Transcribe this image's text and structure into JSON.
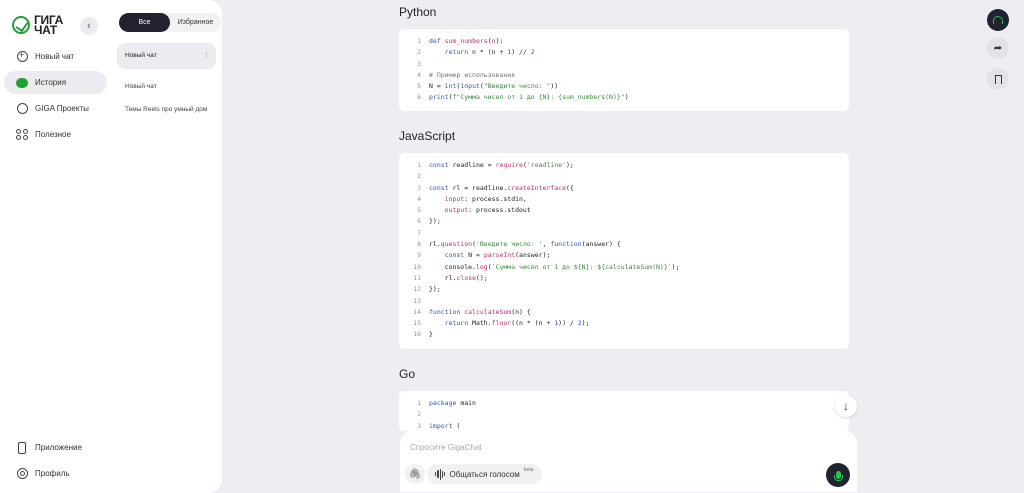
{
  "brand": {
    "name_line1": "ГИГА",
    "name_line2": "ЧАТ"
  },
  "nav": {
    "items": [
      {
        "label": "Новый чат",
        "icon": "plus-circle-icon"
      },
      {
        "label": "История",
        "icon": "chat-bubble-icon"
      },
      {
        "label": "GIGA Проекты",
        "icon": "projects-icon"
      },
      {
        "label": "Полезное",
        "icon": "grid-icon"
      }
    ],
    "bottom": [
      {
        "label": "Приложение",
        "icon": "phone-icon"
      },
      {
        "label": "Профиль",
        "icon": "profile-icon"
      }
    ]
  },
  "history": {
    "filters": [
      "Все",
      "Избранное"
    ],
    "items": [
      "Новый чат",
      "Новый чат",
      "Темы Reels про умный дом"
    ]
  },
  "sections": [
    {
      "title": "Python"
    },
    {
      "title": "JavaScript"
    },
    {
      "title": "Go"
    }
  ],
  "code": {
    "python": [
      "def sum_numbers(n):",
      "    return n * (n + 1) // 2",
      "",
      "# Пример использования",
      "N = int(input(\"Введите число: \"))",
      "print(f\"Сумма чисел от 1 до {N}: {sum_numbers(N)}\")"
    ],
    "javascript": [
      "const readline = require('readline');",
      "",
      "const rl = readline.createInterface({",
      "    input: process.stdin,",
      "    output: process.stdout",
      "});",
      "",
      "rl.question('Введите число: ', function(answer) {",
      "    const N = parseInt(answer);",
      "    console.log(`Сумма чисел от 1 до ${N}: ${calculateSum(N)}`);",
      "    rl.close();",
      "});",
      "",
      "function calculateSum(n) {",
      "    return Math.floor((n * (n + 1)) / 2);",
      "}"
    ],
    "go": [
      "package main",
      "",
      "import ("
    ]
  },
  "composer": {
    "placeholder": "Спросите GigaChat",
    "voice_label": "Общаться голосом",
    "voice_badge": "beta"
  }
}
